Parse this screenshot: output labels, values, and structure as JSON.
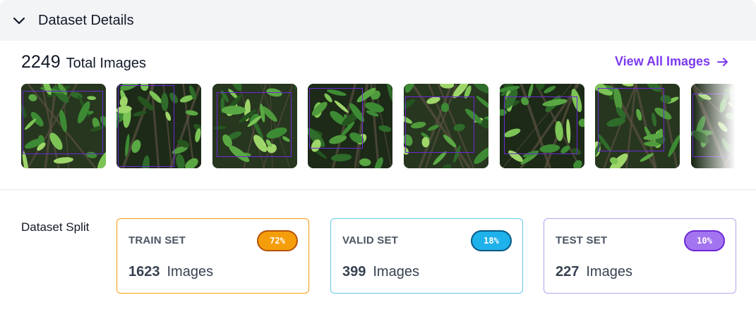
{
  "section": {
    "title": "Dataset Details",
    "collapse_icon": "chevron-down-icon"
  },
  "summary": {
    "total_count": "2249",
    "total_label": "Total Images",
    "view_all_label": "View All Images",
    "view_all_icon": "arrow-right-icon",
    "accent_color": "#7c3aed"
  },
  "thumbnails": [
    {
      "name": "leaf-image-1"
    },
    {
      "name": "leaf-image-2"
    },
    {
      "name": "leaf-image-3"
    },
    {
      "name": "leaf-image-4"
    },
    {
      "name": "leaf-image-5"
    },
    {
      "name": "leaf-image-6"
    },
    {
      "name": "leaf-image-7"
    },
    {
      "name": "leaf-image-8"
    }
  ],
  "split": {
    "label": "Dataset Split",
    "sets": [
      {
        "key": "train",
        "name": "TRAIN SET",
        "percent": "72%",
        "count": "1623",
        "unit": "Images",
        "border_color": "#f59e0b",
        "badge_color": "#f59e0b",
        "badge_border": "#b45309"
      },
      {
        "key": "valid",
        "name": "VALID SET",
        "percent": "18%",
        "count": "399",
        "unit": "Images",
        "border_color": "#67c7e8",
        "badge_color": "#1fb1ea",
        "badge_border": "#075985"
      },
      {
        "key": "test",
        "name": "TEST SET",
        "percent": "10%",
        "count": "227",
        "unit": "Images",
        "border_color": "#b9a3ee",
        "badge_color": "#a374f0",
        "badge_border": "#6d28d9"
      }
    ]
  }
}
